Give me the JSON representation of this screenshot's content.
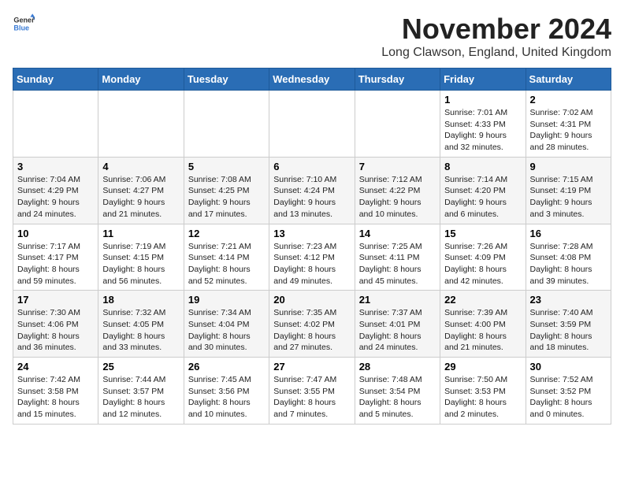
{
  "logo": {
    "general": "General",
    "blue": "Blue"
  },
  "title": {
    "month": "November 2024",
    "location": "Long Clawson, England, United Kingdom"
  },
  "weekdays": [
    "Sunday",
    "Monday",
    "Tuesday",
    "Wednesday",
    "Thursday",
    "Friday",
    "Saturday"
  ],
  "weeks": [
    [
      {
        "day": "",
        "info": ""
      },
      {
        "day": "",
        "info": ""
      },
      {
        "day": "",
        "info": ""
      },
      {
        "day": "",
        "info": ""
      },
      {
        "day": "",
        "info": ""
      },
      {
        "day": "1",
        "info": "Sunrise: 7:01 AM\nSunset: 4:33 PM\nDaylight: 9 hours\nand 32 minutes."
      },
      {
        "day": "2",
        "info": "Sunrise: 7:02 AM\nSunset: 4:31 PM\nDaylight: 9 hours\nand 28 minutes."
      }
    ],
    [
      {
        "day": "3",
        "info": "Sunrise: 7:04 AM\nSunset: 4:29 PM\nDaylight: 9 hours\nand 24 minutes."
      },
      {
        "day": "4",
        "info": "Sunrise: 7:06 AM\nSunset: 4:27 PM\nDaylight: 9 hours\nand 21 minutes."
      },
      {
        "day": "5",
        "info": "Sunrise: 7:08 AM\nSunset: 4:25 PM\nDaylight: 9 hours\nand 17 minutes."
      },
      {
        "day": "6",
        "info": "Sunrise: 7:10 AM\nSunset: 4:24 PM\nDaylight: 9 hours\nand 13 minutes."
      },
      {
        "day": "7",
        "info": "Sunrise: 7:12 AM\nSunset: 4:22 PM\nDaylight: 9 hours\nand 10 minutes."
      },
      {
        "day": "8",
        "info": "Sunrise: 7:14 AM\nSunset: 4:20 PM\nDaylight: 9 hours\nand 6 minutes."
      },
      {
        "day": "9",
        "info": "Sunrise: 7:15 AM\nSunset: 4:19 PM\nDaylight: 9 hours\nand 3 minutes."
      }
    ],
    [
      {
        "day": "10",
        "info": "Sunrise: 7:17 AM\nSunset: 4:17 PM\nDaylight: 8 hours\nand 59 minutes."
      },
      {
        "day": "11",
        "info": "Sunrise: 7:19 AM\nSunset: 4:15 PM\nDaylight: 8 hours\nand 56 minutes."
      },
      {
        "day": "12",
        "info": "Sunrise: 7:21 AM\nSunset: 4:14 PM\nDaylight: 8 hours\nand 52 minutes."
      },
      {
        "day": "13",
        "info": "Sunrise: 7:23 AM\nSunset: 4:12 PM\nDaylight: 8 hours\nand 49 minutes."
      },
      {
        "day": "14",
        "info": "Sunrise: 7:25 AM\nSunset: 4:11 PM\nDaylight: 8 hours\nand 45 minutes."
      },
      {
        "day": "15",
        "info": "Sunrise: 7:26 AM\nSunset: 4:09 PM\nDaylight: 8 hours\nand 42 minutes."
      },
      {
        "day": "16",
        "info": "Sunrise: 7:28 AM\nSunset: 4:08 PM\nDaylight: 8 hours\nand 39 minutes."
      }
    ],
    [
      {
        "day": "17",
        "info": "Sunrise: 7:30 AM\nSunset: 4:06 PM\nDaylight: 8 hours\nand 36 minutes."
      },
      {
        "day": "18",
        "info": "Sunrise: 7:32 AM\nSunset: 4:05 PM\nDaylight: 8 hours\nand 33 minutes."
      },
      {
        "day": "19",
        "info": "Sunrise: 7:34 AM\nSunset: 4:04 PM\nDaylight: 8 hours\nand 30 minutes."
      },
      {
        "day": "20",
        "info": "Sunrise: 7:35 AM\nSunset: 4:02 PM\nDaylight: 8 hours\nand 27 minutes."
      },
      {
        "day": "21",
        "info": "Sunrise: 7:37 AM\nSunset: 4:01 PM\nDaylight: 8 hours\nand 24 minutes."
      },
      {
        "day": "22",
        "info": "Sunrise: 7:39 AM\nSunset: 4:00 PM\nDaylight: 8 hours\nand 21 minutes."
      },
      {
        "day": "23",
        "info": "Sunrise: 7:40 AM\nSunset: 3:59 PM\nDaylight: 8 hours\nand 18 minutes."
      }
    ],
    [
      {
        "day": "24",
        "info": "Sunrise: 7:42 AM\nSunset: 3:58 PM\nDaylight: 8 hours\nand 15 minutes."
      },
      {
        "day": "25",
        "info": "Sunrise: 7:44 AM\nSunset: 3:57 PM\nDaylight: 8 hours\nand 12 minutes."
      },
      {
        "day": "26",
        "info": "Sunrise: 7:45 AM\nSunset: 3:56 PM\nDaylight: 8 hours\nand 10 minutes."
      },
      {
        "day": "27",
        "info": "Sunrise: 7:47 AM\nSunset: 3:55 PM\nDaylight: 8 hours\nand 7 minutes."
      },
      {
        "day": "28",
        "info": "Sunrise: 7:48 AM\nSunset: 3:54 PM\nDaylight: 8 hours\nand 5 minutes."
      },
      {
        "day": "29",
        "info": "Sunrise: 7:50 AM\nSunset: 3:53 PM\nDaylight: 8 hours\nand 2 minutes."
      },
      {
        "day": "30",
        "info": "Sunrise: 7:52 AM\nSunset: 3:52 PM\nDaylight: 8 hours\nand 0 minutes."
      }
    ]
  ]
}
